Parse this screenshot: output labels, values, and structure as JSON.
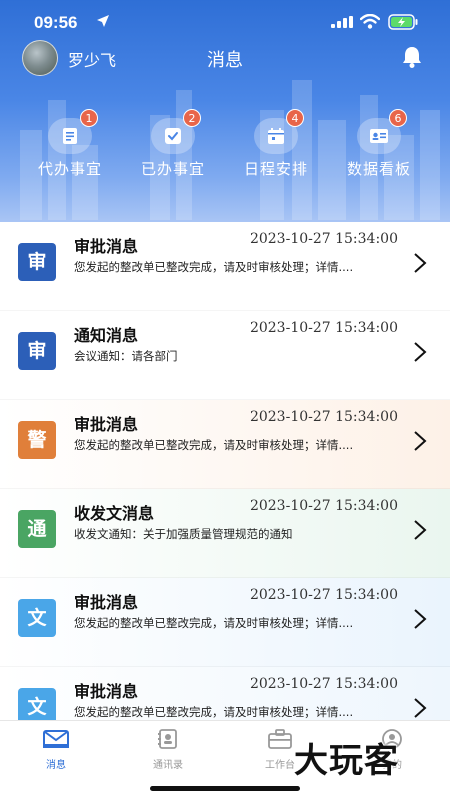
{
  "status_bar": {
    "time": "09:56"
  },
  "user": {
    "name": "罗少飞"
  },
  "page": {
    "title": "消息"
  },
  "quick_actions": [
    {
      "label": "代办事宜",
      "badge": "1",
      "icon": "document-icon"
    },
    {
      "label": "已办事宜",
      "badge": "2",
      "icon": "check-icon"
    },
    {
      "label": "日程安排",
      "badge": "4",
      "icon": "calendar-icon"
    },
    {
      "label": "数据看板",
      "badge": "6",
      "icon": "id-card-icon"
    }
  ],
  "messages": [
    {
      "icon_text": "审",
      "icon_color": "#2c5fb8",
      "bg": "#ffffff",
      "title": "审批消息",
      "time": "2023-10-27 15:34:00",
      "body": "您发起的整改单已整改完成，请及时审核处理；详情...."
    },
    {
      "icon_text": "审",
      "icon_color": "#2c5fb8",
      "bg": "#ffffff",
      "title": "通知消息",
      "time": "2023-10-27 15:34:00",
      "body": "会议通知：请各部门"
    },
    {
      "icon_text": "警",
      "icon_color": "#e07f3a",
      "bg": "#fdf1e7",
      "title": "审批消息",
      "time": "2023-10-27 15:34:00",
      "body": "您发起的整改单已整改完成，请及时审核处理；详情...."
    },
    {
      "icon_text": "通",
      "icon_color": "#4aa563",
      "bg": "#eaf6ef",
      "title": "收发文消息",
      "time": "2023-10-27 15:34:00",
      "body": "收发文通知：关于加强质量管理规范的通知"
    },
    {
      "icon_text": "文",
      "icon_color": "#4aa6e8",
      "bg": "#eaf4fd",
      "title": "审批消息",
      "time": "2023-10-27 15:34:00",
      "body": "您发起的整改单已整改完成，请及时审核处理；详情...."
    },
    {
      "icon_text": "文",
      "icon_color": "#4aa6e8",
      "bg": "#eef6fd",
      "title": "审批消息",
      "time": "2023-10-27 15:34:00",
      "body": "您发起的整改单已整改完成，请及时审核处理；详情...."
    }
  ],
  "tabs": [
    {
      "label": "消息",
      "icon": "mail-icon",
      "active": true
    },
    {
      "label": "通讯录",
      "icon": "contacts-icon",
      "active": false
    },
    {
      "label": "工作台",
      "icon": "briefcase-icon",
      "active": false
    },
    {
      "label": "我的",
      "icon": "profile-icon",
      "active": false
    }
  ],
  "watermark": {
    "text": "大玩客"
  },
  "colors": {
    "primary": "#2f6fd6",
    "badge": "#e8654a"
  }
}
